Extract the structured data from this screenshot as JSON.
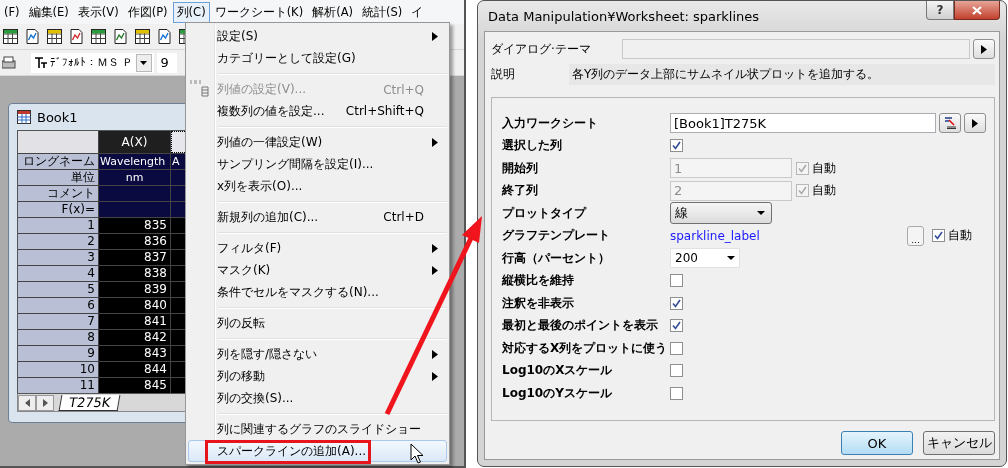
{
  "menubar": [
    {
      "label": "(F)",
      "selected": false
    },
    {
      "label": "編集(E)",
      "selected": false
    },
    {
      "label": "表示(V)",
      "selected": false
    },
    {
      "label": "作図(P)",
      "selected": false
    },
    {
      "label": "列(C)",
      "selected": true
    },
    {
      "label": "ワークシート(K)",
      "selected": false
    },
    {
      "label": "解析(A)",
      "selected": false
    },
    {
      "label": "統計(S)",
      "selected": false
    },
    {
      "label": "イ",
      "selected": false
    }
  ],
  "font_toolbar": {
    "font": "ﾃﾞﾌｫﾙﾄ：ＭＳ Ｐ",
    "size": "9"
  },
  "workbook": {
    "title": "Book1",
    "column_header": "A(X)",
    "label_rows": [
      {
        "label": "ロングネーム",
        "value": "Wavelength",
        "column_2": "A"
      },
      {
        "label": "単位",
        "value": "nm"
      },
      {
        "label": "コメント"
      },
      {
        "label": "F(x)="
      }
    ],
    "rows": [
      {
        "index": "1",
        "value": "835"
      },
      {
        "index": "2",
        "value": "836"
      },
      {
        "index": "3",
        "value": "837"
      },
      {
        "index": "4",
        "value": "838"
      },
      {
        "index": "5",
        "value": "839"
      },
      {
        "index": "6",
        "value": "840"
      },
      {
        "index": "7",
        "value": "841"
      },
      {
        "index": "8",
        "value": "842"
      },
      {
        "index": "9",
        "value": "843"
      },
      {
        "index": "10",
        "value": "844"
      },
      {
        "index": "11",
        "value": "845"
      }
    ],
    "sheet_tab": "T275K"
  },
  "column_menu": {
    "items": [
      {
        "kind": "item",
        "label": "設定(S)",
        "submenu": true,
        "disabled": false,
        "selected": false,
        "callout": false
      },
      {
        "kind": "item",
        "label": "カテゴリーとして設定(G)",
        "submenu": false,
        "disabled": false,
        "selected": false,
        "callout": false
      },
      {
        "kind": "separator"
      },
      {
        "kind": "item",
        "label": "列値の設定(V)...",
        "shortcut": "Ctrl+Q",
        "icon": true,
        "submenu": false,
        "disabled": true,
        "selected": false,
        "callout": false
      },
      {
        "kind": "item",
        "label": "複数列の値を設定...",
        "shortcut": "Ctrl+Shift+Q",
        "submenu": false,
        "disabled": false,
        "selected": false,
        "callout": false
      },
      {
        "kind": "separator"
      },
      {
        "kind": "item",
        "label": "列値の一律設定(W)",
        "submenu": true,
        "disabled": false,
        "selected": false,
        "callout": false
      },
      {
        "kind": "item",
        "label": "サンプリング間隔を設定(I)...",
        "submenu": false,
        "disabled": false,
        "selected": false,
        "callout": false
      },
      {
        "kind": "item",
        "label": "x列を表示(O)...",
        "submenu": false,
        "disabled": false,
        "selected": false,
        "callout": false
      },
      {
        "kind": "separator"
      },
      {
        "kind": "item",
        "label": "新規列の追加(C)...",
        "shortcut": "Ctrl+D",
        "submenu": false,
        "disabled": false,
        "selected": false,
        "callout": false
      },
      {
        "kind": "separator"
      },
      {
        "kind": "item",
        "label": "フィルタ(F)",
        "submenu": true,
        "disabled": false,
        "selected": false,
        "callout": false
      },
      {
        "kind": "item",
        "label": "マスク(K)",
        "submenu": true,
        "disabled": false,
        "selected": false,
        "callout": false
      },
      {
        "kind": "item",
        "label": "条件でセルをマスクする(N)...",
        "submenu": false,
        "disabled": false,
        "selected": false,
        "callout": false
      },
      {
        "kind": "separator"
      },
      {
        "kind": "item",
        "label": "列の反転",
        "submenu": false,
        "disabled": false,
        "selected": false,
        "callout": false
      },
      {
        "kind": "separator"
      },
      {
        "kind": "item",
        "label": "列を隠す/隠さない",
        "submenu": true,
        "disabled": false,
        "selected": false,
        "callout": false
      },
      {
        "kind": "item",
        "label": "列の移動",
        "submenu": true,
        "disabled": false,
        "selected": false,
        "callout": false
      },
      {
        "kind": "item",
        "label": "列の交換(S)...",
        "submenu": false,
        "disabled": false,
        "selected": false,
        "callout": false
      },
      {
        "kind": "separator"
      },
      {
        "kind": "item",
        "label": "列に関連するグラフのスライドショー",
        "submenu": false,
        "disabled": false,
        "selected": false,
        "callout": false
      },
      {
        "kind": "item",
        "label": "スパークラインの追加(A)...",
        "submenu": false,
        "disabled": false,
        "selected": true,
        "callout": true
      }
    ]
  },
  "dialog": {
    "title": "Data Manipulation¥Worksheet: sparklines",
    "help_button": "?",
    "theme": {
      "label": "ダイアログ·テーマ"
    },
    "description": {
      "label": "説明",
      "text": "各Y列のデータ上部にサムネイル状プロットを追加する。"
    },
    "settings": [
      {
        "kind": "worksheet",
        "label": "入力ワークシート",
        "value": "[Book1]T275K"
      },
      {
        "kind": "checkbox",
        "label": "選択した列",
        "checked": true
      },
      {
        "kind": "auto_field",
        "label": "開始列",
        "value": "1",
        "disabled": true,
        "auto_label": "自動",
        "auto_checked": true
      },
      {
        "kind": "auto_field",
        "label": "終了列",
        "value": "2",
        "disabled": true,
        "auto_label": "自動",
        "auto_checked": true
      },
      {
        "kind": "dropdown",
        "label": "プロットタイプ",
        "value": "線"
      },
      {
        "kind": "link",
        "label": "グラフテンプレート",
        "value": "sparkline_label",
        "button_label": "...",
        "auto_label": "自動",
        "auto_checked": true
      },
      {
        "kind": "combo",
        "label": "行高（パーセント）",
        "value": "200"
      },
      {
        "kind": "checkbox",
        "label": "縦横比を維持",
        "checked": false
      },
      {
        "kind": "checkbox",
        "label": "注釈を非表示",
        "checked": true
      },
      {
        "kind": "checkbox",
        "label": "最初と最後のポイントを表示",
        "checked": true
      },
      {
        "kind": "checkbox",
        "label": "対応するX列をプロットに使う",
        "checked": false
      },
      {
        "kind": "checkbox",
        "label": "Log10のXスケール",
        "checked": false
      },
      {
        "kind": "checkbox",
        "label": "Log10のYスケール",
        "checked": false
      }
    ],
    "buttons": [
      {
        "label": "OK",
        "default": true
      },
      {
        "label": "キャンセル",
        "default": false
      }
    ]
  }
}
